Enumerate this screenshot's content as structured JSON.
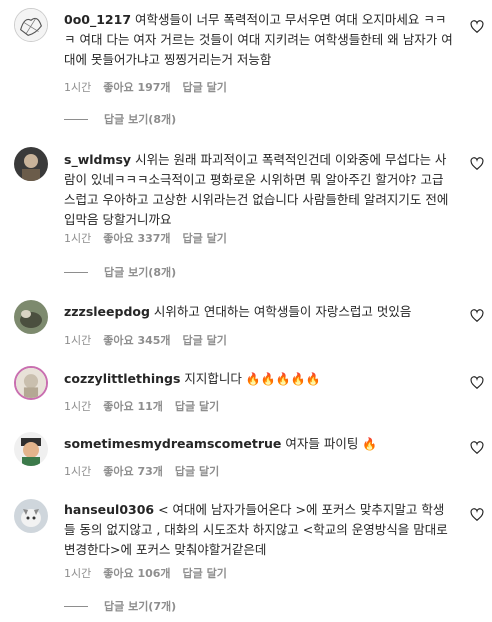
{
  "comments": [
    {
      "username": "0o0_1217",
      "text": "여학생들이 너무 폭력적이고 무서우면 여대 오지마세요 ㅋㅋㅋ 여대 다는 여자 거르는 것들이 여대 지키려는 여학생들한테 왜 남자가 여대에 못들어가냐고 찡찡거리는거 저능함",
      "time": "1시간",
      "likes": "좋아요 197개",
      "reply": "답글 달기",
      "replies": "답글 보기(8개)"
    },
    {
      "username": "s_wldmsy",
      "text": "시위는 원래 파괴적이고 폭력적인건데 이와중에 무섭다는 사람이 있네ㅋㅋㅋ소극적이고 평화로운 시위하면 뭐 알아주긴 할거야? 고급스럽고 우아하고 고상한 시위라는건 없습니다 사람들한테 알려지기도 전에 입막음 당할거니까요",
      "time": "1시간",
      "likes": "좋아요 337개",
      "reply": "답글 달기",
      "replies": "답글 보기(8개)"
    },
    {
      "username": "zzzsleepdog",
      "text": "시위하고 연대하는 여학생들이 자랑스럽고 멋있음",
      "time": "1시간",
      "likes": "좋아요 345개",
      "reply": "답글 달기"
    },
    {
      "username": "cozzylittlethings",
      "text": "지지합니다",
      "emoji": "🔥🔥🔥🔥🔥",
      "time": "1시간",
      "likes": "좋아요 11개",
      "reply": "답글 달기"
    },
    {
      "username": "sometimesmydreamscometrue",
      "text": "여자들 파이팅",
      "emoji": "🔥",
      "time": "1시간",
      "likes": "좋아요 73개",
      "reply": "답글 달기"
    },
    {
      "username": "hanseul0306",
      "text": "< 여대에 남자가들어온다 >에 포커스 맞추지말고 학생들 동의 없지않고 , 대화의 시도조차 하지않고 <학교의 운영방식을 맘대로 변경한다>에 포커스 맞춰야할거같은데",
      "time": "1시간",
      "likes": "좋아요 106개",
      "reply": "답글 달기",
      "replies": "답글 보기(7개)"
    }
  ],
  "icons": {
    "like": "heart-outline-icon"
  },
  "colors": {
    "text": "#262626",
    "meta": "#8e8e8e",
    "background": "#ffffff"
  }
}
